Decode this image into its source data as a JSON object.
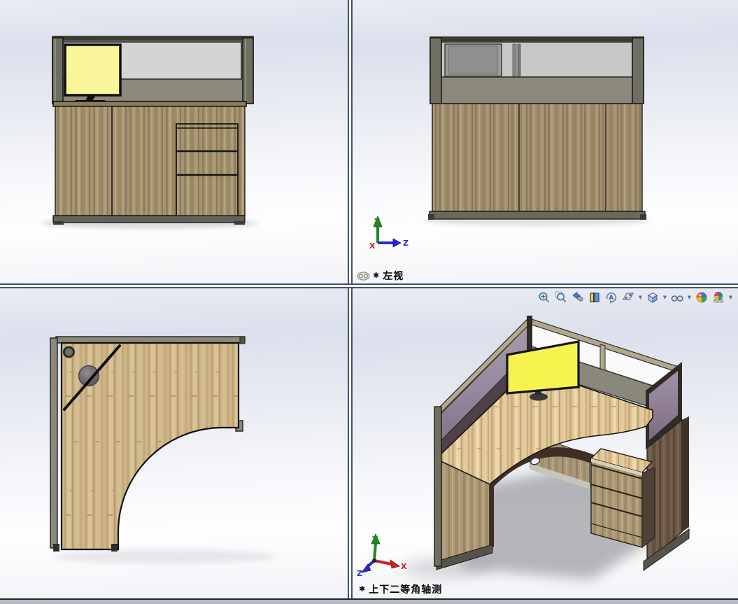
{
  "viewports": {
    "top_left": {
      "view": "side view of workstation",
      "label": ""
    },
    "top_right": {
      "label_star": "✱",
      "label": "左视",
      "linked_icon": "chain-link",
      "triad": {
        "up": "Y",
        "right": "Z",
        "out": "X"
      }
    },
    "bottom_left": {
      "view": "top view of L-shaped desktop",
      "label": ""
    },
    "bottom_right": {
      "label_star": "✱",
      "label": "上下二等角轴测",
      "triad": {
        "up": "Y",
        "right_down": "X",
        "left_down": "Z"
      }
    }
  },
  "toolbar": {
    "icons": [
      {
        "name": "zoom-to-fit",
        "dropdown": false
      },
      {
        "name": "zoom-to-area",
        "dropdown": false
      },
      {
        "name": "previous-view",
        "dropdown": false
      },
      {
        "name": "section-view",
        "dropdown": false
      },
      {
        "name": "rotate-view",
        "dropdown": false
      },
      {
        "name": "view-orientation",
        "dropdown": true
      },
      {
        "name": "display-style",
        "dropdown": true
      },
      {
        "name": "hide-show-items",
        "dropdown": true
      },
      {
        "name": "edit-appearance",
        "dropdown": false
      },
      {
        "name": "apply-scene",
        "dropdown": true
      }
    ]
  },
  "colors": {
    "background_top": "#dce0eb",
    "background_bottom": "#f2f3f7",
    "divider": "#44536e",
    "frame_olive": "#8b897c",
    "frame_dark": "#3b3b33",
    "glass": "#d3d4d3",
    "wood_panel": "#a59473",
    "desktop_bamboo": "#ccb488",
    "desktop_iso": "#ddc396",
    "pedestal_dark": "#6b5847",
    "mauve_panel": "#93859b",
    "monitor_screen": "#f8f59b",
    "monitor_screen_iso": "#f6f351",
    "axis_x": "#cc2222",
    "axis_y": "#1e8a1e",
    "axis_z": "#2a2ad0"
  }
}
